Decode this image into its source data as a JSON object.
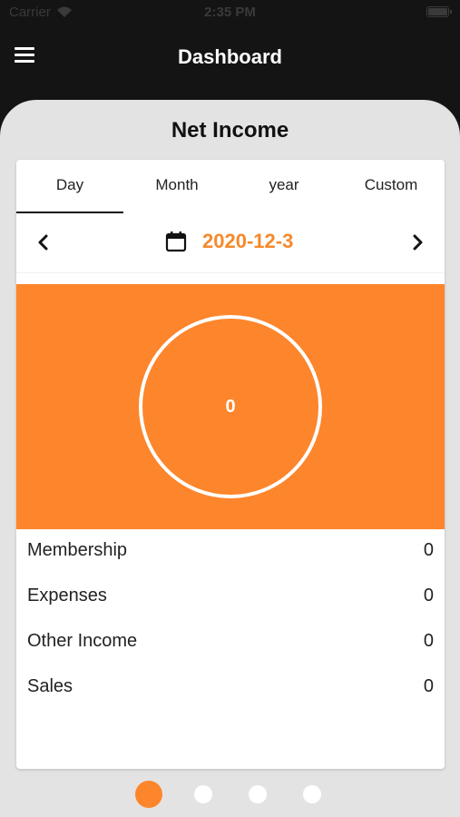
{
  "status_bar": {
    "carrier": "Carrier",
    "time": "2:35 PM"
  },
  "header": {
    "title": "Dashboard",
    "menu_icon": "hamburger-menu-icon"
  },
  "sheet": {
    "title": "Net Income"
  },
  "tabs": [
    {
      "label": "Day",
      "active": true
    },
    {
      "label": "Month",
      "active": false
    },
    {
      "label": "year",
      "active": false
    },
    {
      "label": "Custom",
      "active": false
    }
  ],
  "date_nav": {
    "date": "2020-12-3",
    "prev_icon": "chevron-left-icon",
    "next_icon": "chevron-right-icon",
    "calendar_icon": "calendar-icon"
  },
  "summary": {
    "total": "0"
  },
  "rows": [
    {
      "label": "Membership",
      "value": "0"
    },
    {
      "label": "Expenses",
      "value": "0"
    },
    {
      "label": "Other Income",
      "value": "0"
    },
    {
      "label": "Sales",
      "value": "0"
    }
  ],
  "pager": {
    "count": 4,
    "active_index": 0
  },
  "colors": {
    "accent": "#fd852b",
    "accent_text": "#f6892b",
    "background": "#141414",
    "sheet": "#e3e3e3"
  }
}
